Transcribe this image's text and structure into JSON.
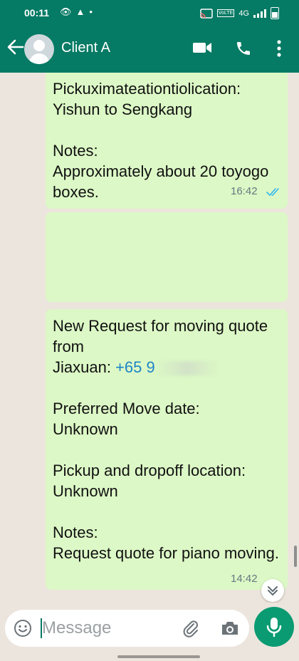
{
  "status_bar": {
    "time": "00:11",
    "network_label": "4G",
    "volte_label": "VoLTE",
    "icons": [
      "eye-icon",
      "alert-icon",
      "dot-icon",
      "cast-icon",
      "signal-icon",
      "battery-icon"
    ]
  },
  "header": {
    "contact_name": "Client A",
    "icons": [
      "back-arrow-icon",
      "avatar-icon",
      "video-call-icon",
      "phone-icon",
      "more-vert-icon"
    ]
  },
  "messages": [
    {
      "text": "Pickuximateationtiolication:\nYishun to Sengkang\n\nNotes:\nApproximately about 20 toyogo boxes.",
      "time": "16:42",
      "status": "read"
    },
    {
      "text": "",
      "time": ""
    },
    {
      "line1": "New Request for moving quote from",
      "prefix": "Jiaxuan: ",
      "phone": "+65 9",
      "body": "Preferred Move date:\nUnknown\n\nPickup and dropoff location:\nUnknown\n\nNotes:\nRequest quote for piano moving.",
      "time": "14:42"
    }
  ],
  "composer": {
    "placeholder": "Message",
    "icons": [
      "emoji-icon",
      "attach-icon",
      "camera-icon",
      "mic-icon"
    ]
  },
  "colors": {
    "header_green": "#057a64",
    "bubble_green": "#dcf8c6",
    "chat_bg": "#ece5dd",
    "read_ticks": "#34b7f1",
    "mic_button": "#0a9b72"
  }
}
